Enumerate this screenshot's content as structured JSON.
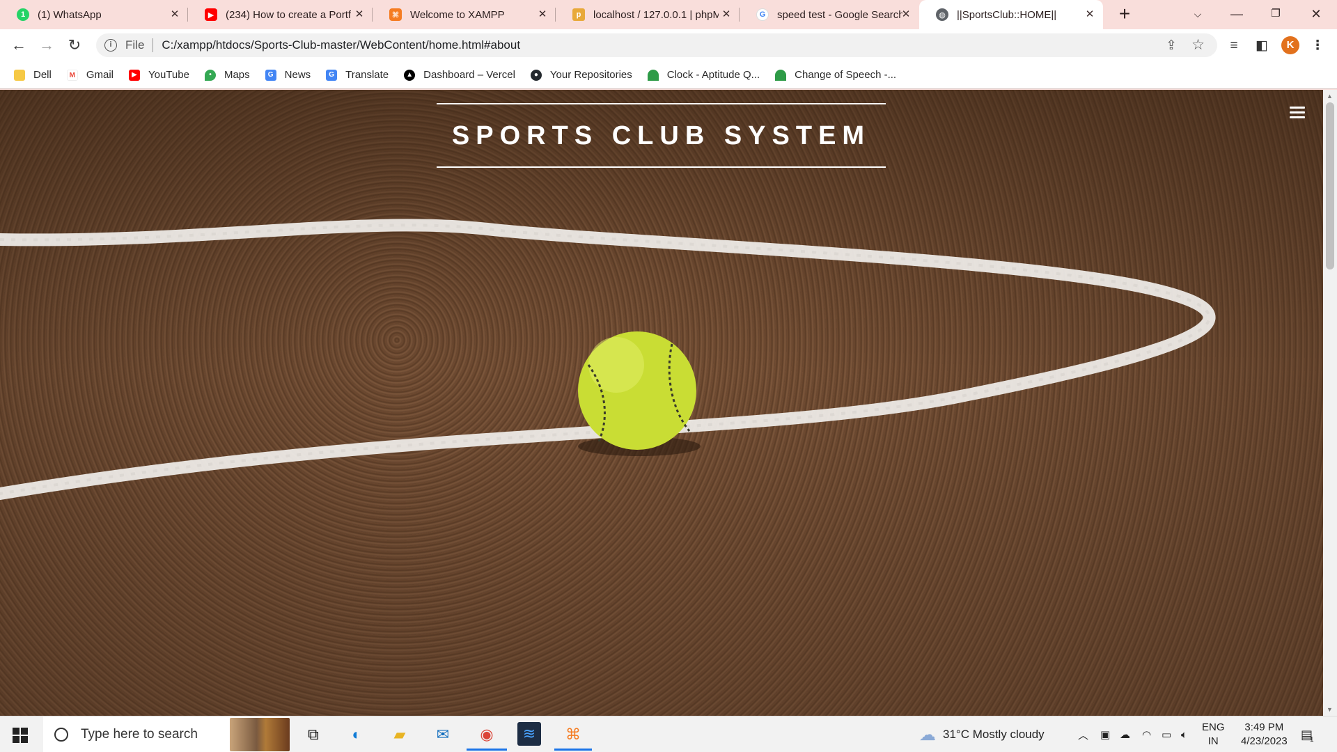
{
  "tabs": [
    {
      "title": "(1) WhatsApp",
      "icon": "whatsapp-icon",
      "color": "#25d366",
      "glyph": "1"
    },
    {
      "title": "(234) How to create a Portfo",
      "icon": "youtube-icon",
      "color": "#ff0000",
      "glyph": "▶"
    },
    {
      "title": "Welcome to XAMPP",
      "icon": "xampp-icon",
      "color": "#f57c22",
      "glyph": "⌘"
    },
    {
      "title": "localhost / 127.0.0.1 | phpMy",
      "icon": "phpmyadmin-icon",
      "color": "#e8a93a",
      "glyph": "p"
    },
    {
      "title": "speed test - Google Search",
      "icon": "google-icon",
      "color": "#4285f4",
      "glyph": "G"
    },
    {
      "title": "||SportsClub::HOME||",
      "icon": "globe-icon",
      "color": "#5f6368",
      "glyph": "◍"
    }
  ],
  "address": {
    "scheme_label": "File",
    "url": "C:/xampp/htdocs/Sports-Club-master/WebContent/home.html#about"
  },
  "profile": {
    "initial": "K"
  },
  "bookmarks": [
    {
      "label": "Dell",
      "icon": "folder-icon",
      "color": "#f6c945"
    },
    {
      "label": "Gmail",
      "icon": "gmail-icon",
      "color": "#ea4335"
    },
    {
      "label": "YouTube",
      "icon": "youtube-icon",
      "color": "#ff0000"
    },
    {
      "label": "Maps",
      "icon": "maps-icon",
      "color": "#34a853"
    },
    {
      "label": "News",
      "icon": "news-icon",
      "color": "#4285f4"
    },
    {
      "label": "Translate",
      "icon": "translate-icon",
      "color": "#4285f4"
    },
    {
      "label": "Dashboard – Vercel",
      "icon": "vercel-icon",
      "color": "#000000"
    },
    {
      "label": "Your Repositories",
      "icon": "github-icon",
      "color": "#24292e"
    },
    {
      "label": "Clock - Aptitude Q...",
      "icon": "palm-icon",
      "color": "#2e9b47"
    },
    {
      "label": "Change of Speech -...",
      "icon": "palm-icon",
      "color": "#2e9b47"
    }
  ],
  "page": {
    "brand": "SPORTS CLUB SYSTEM"
  },
  "taskbar": {
    "search_placeholder": "Type here to search",
    "weather": "31°C  Mostly cloudy",
    "lang_top": "ENG",
    "lang_bottom": "IN",
    "time": "3:49 PM",
    "date": "4/23/2023",
    "notifications": "1"
  }
}
